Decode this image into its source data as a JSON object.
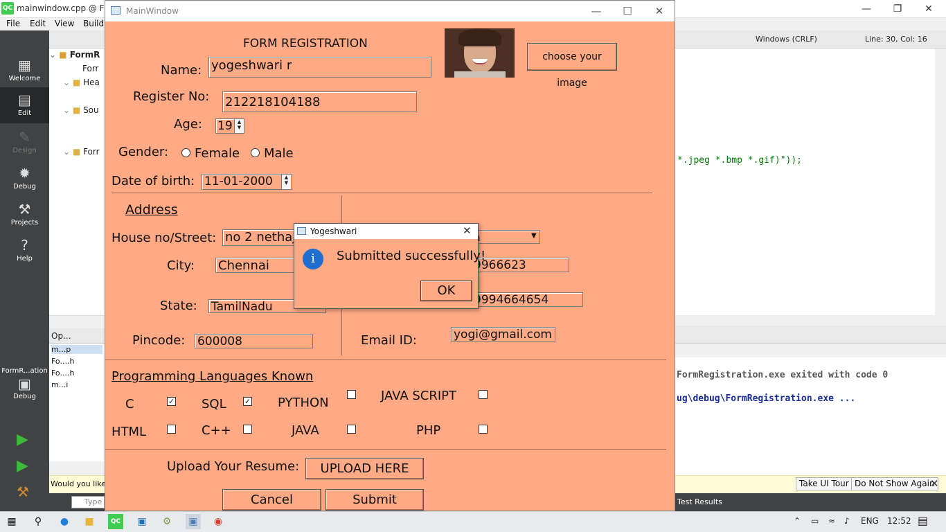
{
  "qt_creator": {
    "window_title": "mainwindow.cpp @ For",
    "menu": [
      "File",
      "Edit",
      "View",
      "Build"
    ],
    "modes": [
      {
        "label": "Welcome",
        "icon": "grid-icon"
      },
      {
        "label": "Edit",
        "icon": "edit-document-icon"
      },
      {
        "label": "Design",
        "icon": "pencil-icon"
      },
      {
        "label": "Debug",
        "icon": "bug-icon"
      },
      {
        "label": "Projects",
        "icon": "wrench-icon"
      },
      {
        "label": "Help",
        "icon": "help-icon"
      }
    ],
    "kit": {
      "name": "FormR...ation",
      "mode": "Debug"
    },
    "project_tree": [
      "FormR",
      "Forr",
      "Hea",
      "Sou",
      "Forr"
    ],
    "open_documents_header": "Op...",
    "open_documents": [
      "m...p",
      "Fo....h",
      "Fo....h",
      "m...i"
    ],
    "encoding": "Windows (CRLF)",
    "cursor_position": "Line: 30, Col: 16",
    "code_fragment": "*.jpeg *.bmp *.gif)\"));",
    "output_lines": [
      "FormRegistration.exe exited with code 0",
      "ug\\debug\\FormRegistration.exe ..."
    ],
    "info_bar": {
      "text": "Would you like t",
      "take_tour": "Take UI Tour",
      "dont_show": "Do Not Show Again"
    },
    "locator_placeholder": "Type",
    "status_tab": "Test Results"
  },
  "main_window": {
    "title": "MainWindow",
    "form_title": "FORM REGISTRATION",
    "choose_image_button": "choose your image",
    "fields": {
      "name": {
        "label": "Name:",
        "value": "yogeshwari r"
      },
      "register_no": {
        "label": "Register No:",
        "value": "212218104188"
      },
      "age": {
        "label": "Age:",
        "value": "19"
      },
      "gender": {
        "label": "Gender:",
        "options": [
          "Female",
          "Male"
        ]
      },
      "dob": {
        "label": "Date of  birth:",
        "value": "11-01-2000"
      }
    },
    "address": {
      "heading": "Address",
      "house_street": {
        "label": "House no/Street:",
        "value": "no 2 nethaji"
      },
      "city": {
        "label": "City:",
        "value": "Chennai"
      },
      "state": {
        "label": "State:",
        "value": "TamilNadu"
      },
      "pincode": {
        "label": "Pincode:",
        "value": "600008"
      },
      "right_combo_value": "a",
      "phone_1": "9966623",
      "phone_2": "9994664654",
      "email": {
        "label": "Email ID:",
        "value": "yogi@gmail.com"
      }
    },
    "languages": {
      "heading": "Programming  Languages Known",
      "items": [
        {
          "label": "C",
          "checked": true
        },
        {
          "label": "SQL",
          "checked": true
        },
        {
          "label": "PYTHON",
          "checked": false
        },
        {
          "label": "JAVA SCRIPT",
          "checked": false
        },
        {
          "label": "HTML",
          "checked": false
        },
        {
          "label": "C++",
          "checked": false
        },
        {
          "label": "JAVA",
          "checked": false
        },
        {
          "label": "PHP",
          "checked": false
        }
      ]
    },
    "resume": {
      "label": "Upload Your Resume:",
      "button": "UPLOAD HERE"
    },
    "cancel_button": "Cancel",
    "submit_button": "Submit",
    "background_color": "#ffa985"
  },
  "dialog": {
    "title": "Yogeshwari",
    "message": "Submitted successfully!",
    "ok_button": "OK",
    "icon": "info-icon"
  },
  "taskbar": {
    "language": "ENG",
    "time": "12:52"
  }
}
